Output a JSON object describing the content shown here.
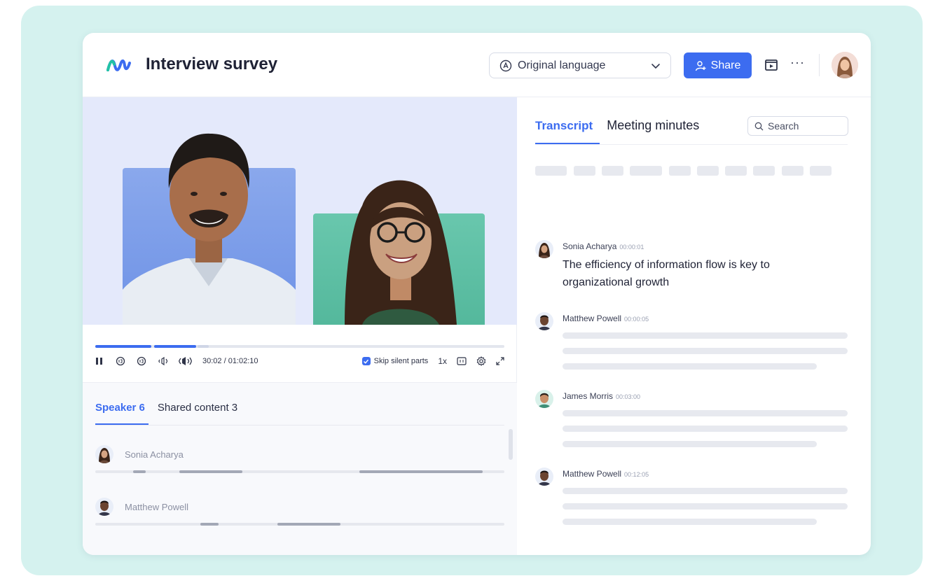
{
  "header": {
    "title": "Interview survey",
    "language_select": "Original language",
    "share_label": "Share"
  },
  "player": {
    "time": "30:02 / 01:02:10",
    "skip_label": "Skip silent parts",
    "speed": "1x",
    "progress_fraction": 0.28
  },
  "speakers_panel": {
    "tabs": [
      {
        "label": "Speaker 6",
        "active": true
      },
      {
        "label": "Shared content 3",
        "active": false
      }
    ],
    "speakers": [
      {
        "name": "Sonia Acharya"
      },
      {
        "name": "Matthew Powell"
      }
    ]
  },
  "transcript_panel": {
    "tabs": [
      {
        "label": "Transcript",
        "active": true
      },
      {
        "label": "Meeting minutes",
        "active": false
      }
    ],
    "search_placeholder": "Search",
    "entries": [
      {
        "speaker": "Sonia Acharya",
        "time": "00:00:01",
        "text": "The efficiency of information flow is key to organizational growth"
      },
      {
        "speaker": "Matthew Powell",
        "time": "00:00:05",
        "text": ""
      },
      {
        "speaker": "James Morris",
        "time": "00:03:00",
        "text": ""
      },
      {
        "speaker": "Matthew Powell",
        "time": "00:12:05",
        "text": ""
      }
    ]
  },
  "colors": {
    "accent": "#3c6cf0",
    "background_tint": "#d5f2ef"
  },
  "icons": [
    "logo-icon",
    "globe-icon",
    "chevron-down-icon",
    "add-user-icon",
    "present-icon",
    "more-icon",
    "pause-icon",
    "rewind-icon",
    "forward-icon",
    "volume-icon",
    "speaker-icon",
    "captions-icon",
    "settings-icon",
    "fullscreen-icon",
    "search-icon"
  ]
}
